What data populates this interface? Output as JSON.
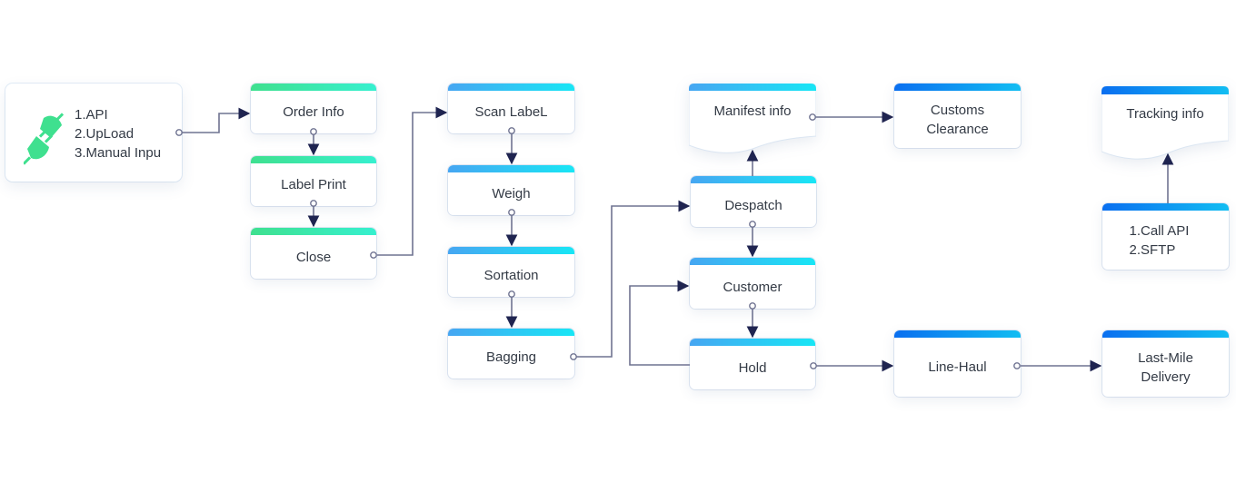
{
  "colors": {
    "green_start": "#3fe08f",
    "green_end": "#36f0cf",
    "cyan_start": "#46a6f2",
    "cyan_end": "#18e6f5",
    "blue_start": "#0a6ff0",
    "blue_end": "#12bdf2",
    "connector": "#6f7391",
    "arrowhead": "#1f2450",
    "text": "#333a45"
  },
  "source": {
    "icon": "plug-icon",
    "lines": [
      "1.API",
      "2.UpLoad",
      "3.Manual Inpu"
    ]
  },
  "nodes": {
    "order_info": {
      "label": "Order Info"
    },
    "label_print": {
      "label": "Label Print"
    },
    "close": {
      "label": "Close"
    },
    "scan_label": {
      "label": "Scan LabeL"
    },
    "weigh": {
      "label": "Weigh"
    },
    "sortation": {
      "label": "Sortation"
    },
    "bagging": {
      "label": "Bagging"
    },
    "manifest_info": {
      "label": "Manifest info"
    },
    "despatch": {
      "label": "Despatch"
    },
    "customer": {
      "label": "Customer"
    },
    "hold": {
      "label": "Hold"
    },
    "customs_clearance": {
      "label_line1": "Customs",
      "label_line2": "Clearance"
    },
    "line_haul": {
      "label": "Line-Haul"
    },
    "tracking_info": {
      "label": "Tracking info"
    },
    "call_api_sftp": {
      "label_line1": "1.Call API",
      "label_line2": "2.SFTP"
    },
    "last_mile_delivery": {
      "label_line1": "Last-Mile",
      "label_line2": "Delivery"
    }
  },
  "edges": [
    {
      "from": "source",
      "to": "order_info"
    },
    {
      "from": "order_info",
      "to": "label_print"
    },
    {
      "from": "label_print",
      "to": "close"
    },
    {
      "from": "close",
      "to": "scan_label"
    },
    {
      "from": "scan_label",
      "to": "weigh"
    },
    {
      "from": "weigh",
      "to": "sortation"
    },
    {
      "from": "sortation",
      "to": "bagging"
    },
    {
      "from": "bagging",
      "to": "despatch"
    },
    {
      "from": "despatch",
      "to": "manifest_info"
    },
    {
      "from": "despatch",
      "to": "customer"
    },
    {
      "from": "customer",
      "to": "hold"
    },
    {
      "from": "hold",
      "to": "customer"
    },
    {
      "from": "manifest_info",
      "to": "customs_clearance"
    },
    {
      "from": "hold",
      "to": "line_haul"
    },
    {
      "from": "line_haul",
      "to": "last_mile_delivery"
    },
    {
      "from": "call_api_sftp",
      "to": "tracking_info"
    }
  ]
}
